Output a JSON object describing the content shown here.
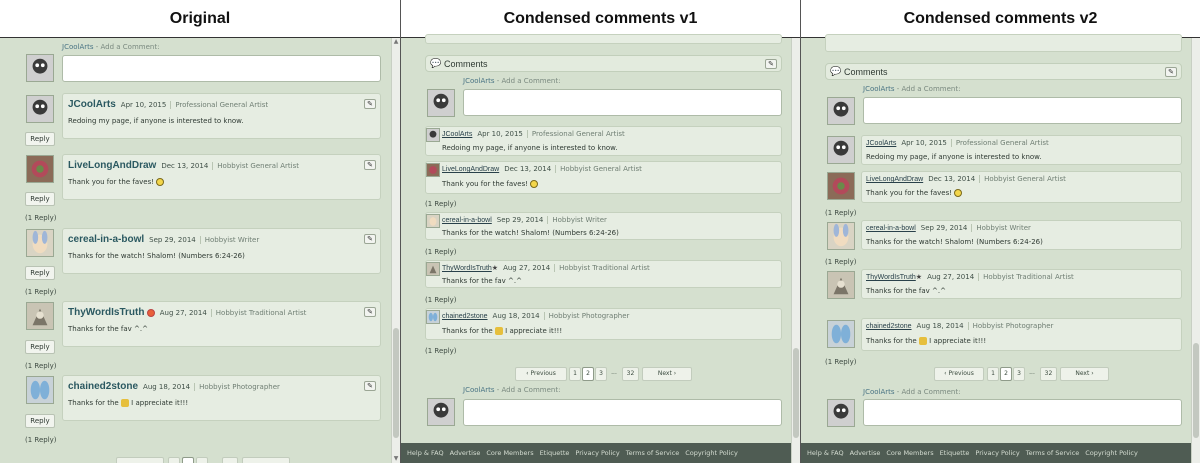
{
  "titles": [
    "Original",
    "Condensed comments v1",
    "Condensed comments v2"
  ],
  "add_comment": {
    "user": "JCoolArts",
    "label": " - Add a Comment:"
  },
  "section_title": "Comments",
  "reply_label": "Reply",
  "reply_count": "(1 Reply)",
  "comments": [
    {
      "user": "JCoolArts",
      "date": "Apr 10, 2015",
      "role": "Professional General Artist",
      "text": "Redoing my page, if anyone is interested to know."
    },
    {
      "user": "LiveLongAndDraw",
      "date": "Dec 13, 2014",
      "role": "Hobbyist General Artist",
      "text": "Thank you for the faves!"
    },
    {
      "user": "cereal-in-a-bowl",
      "date": "Sep 29, 2014",
      "role": "Hobbyist Writer",
      "text": "Thanks for the watch! Shalom! (Numbers 6:24-26)"
    },
    {
      "user": "ThyWordIsTruth",
      "user_alt": "ThyWordIsTruth",
      "date": "Aug 27, 2014",
      "role": "Hobbyist Traditional Artist",
      "text": "Thanks for the fav ^.^"
    },
    {
      "user": "chained2stone",
      "date": "Aug 18, 2014",
      "role": "Hobbyist Photographer",
      "text_pre": "Thanks for the",
      "text_post": "I appreciate it!!!"
    }
  ],
  "pager": {
    "prev": "Previous",
    "next": "Next",
    "pages": [
      "1",
      "2",
      "3",
      "...",
      "32"
    ],
    "current": "2"
  },
  "footer": [
    "Help & FAQ",
    "Advertise",
    "Core Members",
    "Etiquette",
    "Privacy Policy",
    "Terms of Service",
    "Copyright Policy"
  ],
  "icons": {
    "edit": "pencil-icon",
    "comments": "speech-bubble-icon",
    "emoji": "smiley-icon",
    "bug": "bug-icon",
    "badge": "badge-icon",
    "star": "star-icon"
  }
}
